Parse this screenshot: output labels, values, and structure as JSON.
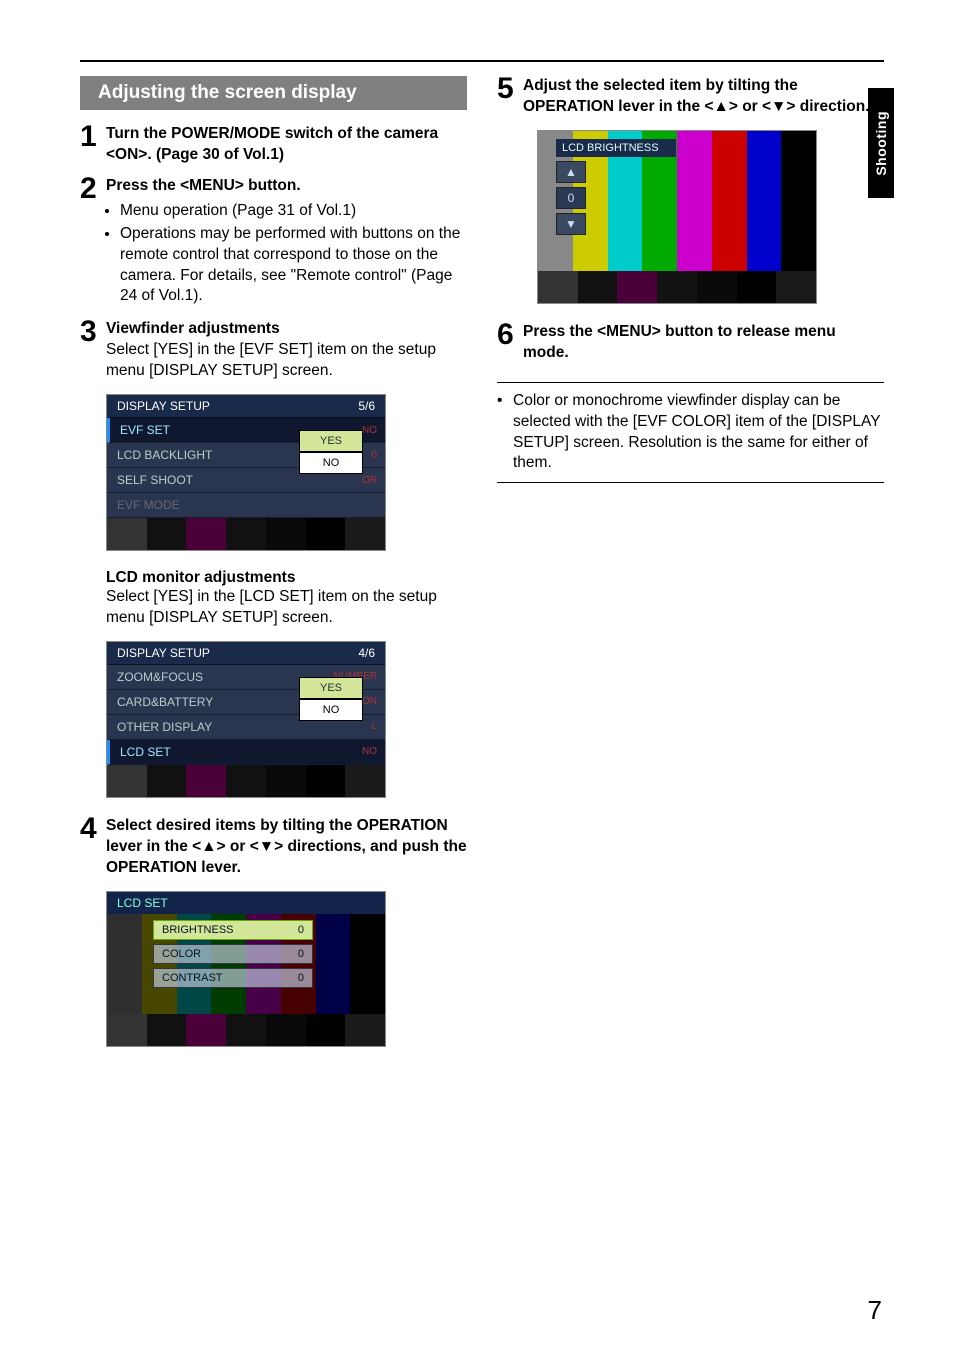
{
  "side_tab": "Shooting",
  "page_number": "7",
  "section_title": "Adjusting the screen display",
  "steps": {
    "s1": {
      "num": "1",
      "title": "Turn the POWER/MODE switch of the camera <ON>. (Page 30 of Vol.1)"
    },
    "s2": {
      "num": "2",
      "title": "Press the <MENU> button.",
      "bullets": [
        "Menu operation (Page 31 of Vol.1)",
        "Operations may be performed with buttons on the remote control that correspond to those on the camera. For details, see \"Remote control\" (Page 24 of Vol.1)."
      ]
    },
    "s3": {
      "num": "3",
      "title": "Viewfinder adjustments",
      "text": "Select [YES] in the [EVF SET] item on the setup menu [DISPLAY SETUP] screen.",
      "sub_heading": "LCD monitor adjustments",
      "sub_text": "Select [YES] in the [LCD SET] item on the setup menu [DISPLAY SETUP] screen."
    },
    "s4": {
      "num": "4",
      "title": "Select desired items by tilting the OPERATION lever in the <▲> or <▼> directions, and push the OPERATION lever."
    },
    "s5": {
      "num": "5",
      "title": "Adjust the selected item by tilting the OPERATION lever in the <▲> or <▼> direction."
    },
    "s6": {
      "num": "6",
      "title": "Press the <MENU> button to release menu mode."
    }
  },
  "note": "Color or monochrome viewfinder display can be selected with the [EVF COLOR] item of the [DISPLAY SETUP] screen. Resolution is the same for either of them.",
  "popup": {
    "yes": "YES",
    "no": "NO"
  },
  "panel_ds5": {
    "title": "DISPLAY SETUP",
    "page": "5/6",
    "rows": [
      {
        "label": "EVF SET",
        "val": "NO",
        "sel": true
      },
      {
        "label": "LCD BACKLIGHT",
        "val": "0"
      },
      {
        "label": "SELF SHOOT",
        "val": "OR"
      },
      {
        "label": "EVF MODE",
        "val": "",
        "dim": true
      }
    ]
  },
  "panel_ds4": {
    "title": "DISPLAY SETUP",
    "page": "4/6",
    "rows": [
      {
        "label": "ZOOM&FOCUS",
        "val": "NUMBER"
      },
      {
        "label": "CARD&BATTERY",
        "val": "ON"
      },
      {
        "label": "OTHER DISPLAY",
        "val": "L"
      },
      {
        "label": "LCD SET",
        "val": "NO",
        "sel": true
      }
    ]
  },
  "panel_lcdset": {
    "title": "LCD SET",
    "items": [
      {
        "label": "BRIGHTNESS",
        "val": "0",
        "hl": true
      },
      {
        "label": "COLOR",
        "val": "0"
      },
      {
        "label": "CONTRAST",
        "val": "0"
      }
    ]
  },
  "panel_bright": {
    "title": "LCD BRIGHTNESS",
    "value": "0"
  }
}
